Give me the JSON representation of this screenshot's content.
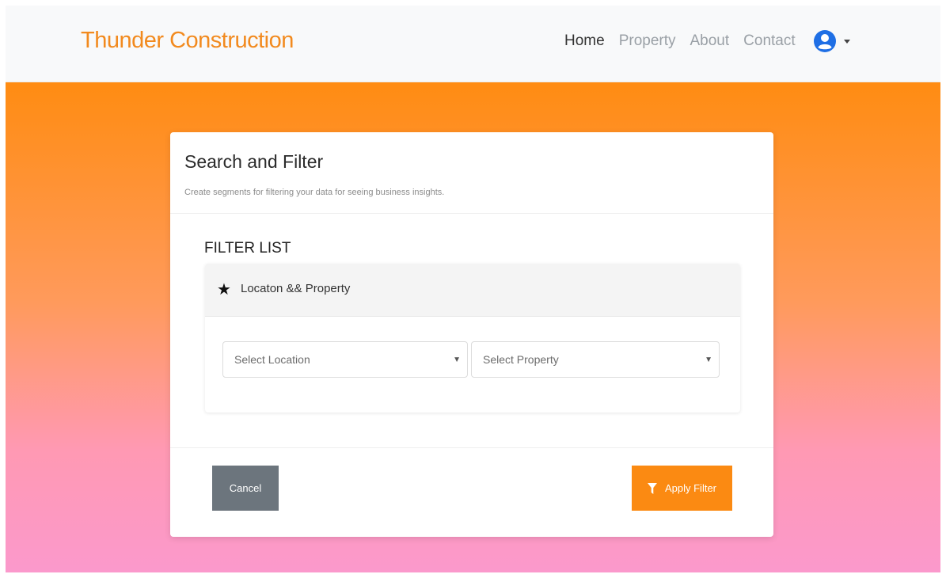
{
  "nav": {
    "brand": "Thunder Construction",
    "links": [
      {
        "label": "Home",
        "active": true
      },
      {
        "label": "Property",
        "active": false
      },
      {
        "label": "About",
        "active": false
      },
      {
        "label": "Contact",
        "active": false
      }
    ],
    "user_icon": "user-circle-icon"
  },
  "card": {
    "title": "Search and Filter",
    "subtitle": "Create segments for filtering your data for seeing business insights.",
    "filter_heading": "FILTER LIST",
    "panel_title": "Locaton && Property",
    "panel_icon": "star-icon",
    "location_select": {
      "placeholder": "Select Location"
    },
    "property_select": {
      "placeholder": "Select Property"
    },
    "cancel_label": "Cancel",
    "apply_label": "Apply Filter",
    "apply_icon": "filter-icon"
  },
  "colors": {
    "brand": "#f28a1e",
    "accent": "#fb8a12",
    "cancel": "#6c757d",
    "user_icon": "#1f6fe5"
  }
}
